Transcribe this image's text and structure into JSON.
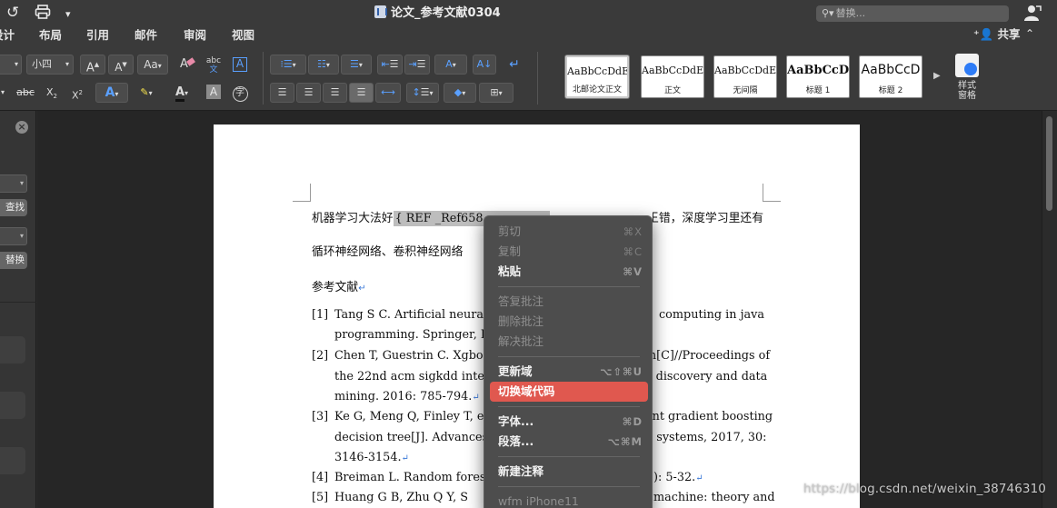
{
  "titlebar": {
    "title": "论文_参考文献0304",
    "search_placeholder": "替换...",
    "icons": [
      "undo-icon",
      "print-icon",
      "customize-toolbar-icon",
      "search-icon",
      "account-icon"
    ]
  },
  "menubar": {
    "tabs": [
      "设计",
      "布局",
      "引用",
      "邮件",
      "审阅",
      "视图"
    ],
    "share_label": "共享"
  },
  "ribbon": {
    "font_size": "小四",
    "abc_label": "abc",
    "styles": [
      {
        "sample": "AaBbCcDdE",
        "name": "北邮论文正文"
      },
      {
        "sample": "AaBbCcDdEe",
        "name": "正文"
      },
      {
        "sample": "AaBbCcDdEe",
        "name": "无间隔"
      },
      {
        "sample": "AaBbCcDd",
        "name": "标题 1"
      },
      {
        "sample": "AaBbCcD",
        "name": "标题 2"
      }
    ],
    "styles_pane_label_1": "样式",
    "styles_pane_label_2": "窗格"
  },
  "sidebar": {
    "find_label": "查找",
    "replace_label": "替换"
  },
  "document": {
    "line1_before": "机器学习大法好",
    "field_code": "{ REF _Ref658",
    "line1_after": "数据挖掘大王错，深度学习里还有",
    "line2": "循环神经网络、卷积神经网络",
    "heading": "参考文献",
    "refs": [
      {
        "num": "[1]",
        "lines": [
          "Tang S C. Artificial neura",
          "computing in java",
          "programming. Springer, Bos"
        ]
      },
      {
        "num": "[2]",
        "lines": [
          "Chen T, Guestrin C. Xgboos",
          "m[C]//Proceedings of",
          "the 22nd acm sigkdd interna",
          "e discovery and data",
          "mining. 2016: 785-794."
        ]
      },
      {
        "num": "[3]",
        "lines": [
          "Ke G, Meng Q, Finley T, e",
          "ent gradient boosting",
          "decision tree[J]. Advances i",
          "g systems, 2017, 30:",
          "3146-3154."
        ]
      },
      {
        "num": "[4]",
        "lines": [
          "Breiman L. Random forests[",
          "): 5-32."
        ]
      },
      {
        "num": "[5]",
        "lines": [
          "Huang G B, Zhu Q Y, S",
          "machine: theory and"
        ]
      }
    ]
  },
  "context_menu": {
    "items": [
      {
        "label": "剪切",
        "shortcut": "⌘X",
        "enabled": false
      },
      {
        "label": "复制",
        "shortcut": "⌘C",
        "enabled": false
      },
      {
        "label": "粘贴",
        "shortcut": "⌘V",
        "enabled": true
      },
      {
        "label": "答复批注",
        "shortcut": "",
        "enabled": false
      },
      {
        "label": "删除批注",
        "shortcut": "",
        "enabled": false
      },
      {
        "label": "解决批注",
        "shortcut": "",
        "enabled": false
      },
      {
        "label": "更新域",
        "shortcut": "⌥⇧⌘U",
        "enabled": true
      },
      {
        "label": "切换域代码",
        "shortcut": "",
        "enabled": true,
        "highlighted": true
      },
      {
        "label": "字体...",
        "shortcut": "⌘D",
        "enabled": true
      },
      {
        "label": "段落...",
        "shortcut": "⌥⌘M",
        "enabled": true
      },
      {
        "label": "新建注释",
        "shortcut": "",
        "enabled": true
      },
      {
        "label": "wfm iPhone11",
        "shortcut": "",
        "enabled": false
      }
    ]
  },
  "colors": {
    "highlight": "#e0584f",
    "field_shading": "#bdbdbd",
    "accent_blue": "#2e7cf6"
  },
  "watermark": "https://blog.csdn.net/weixin_38746310"
}
